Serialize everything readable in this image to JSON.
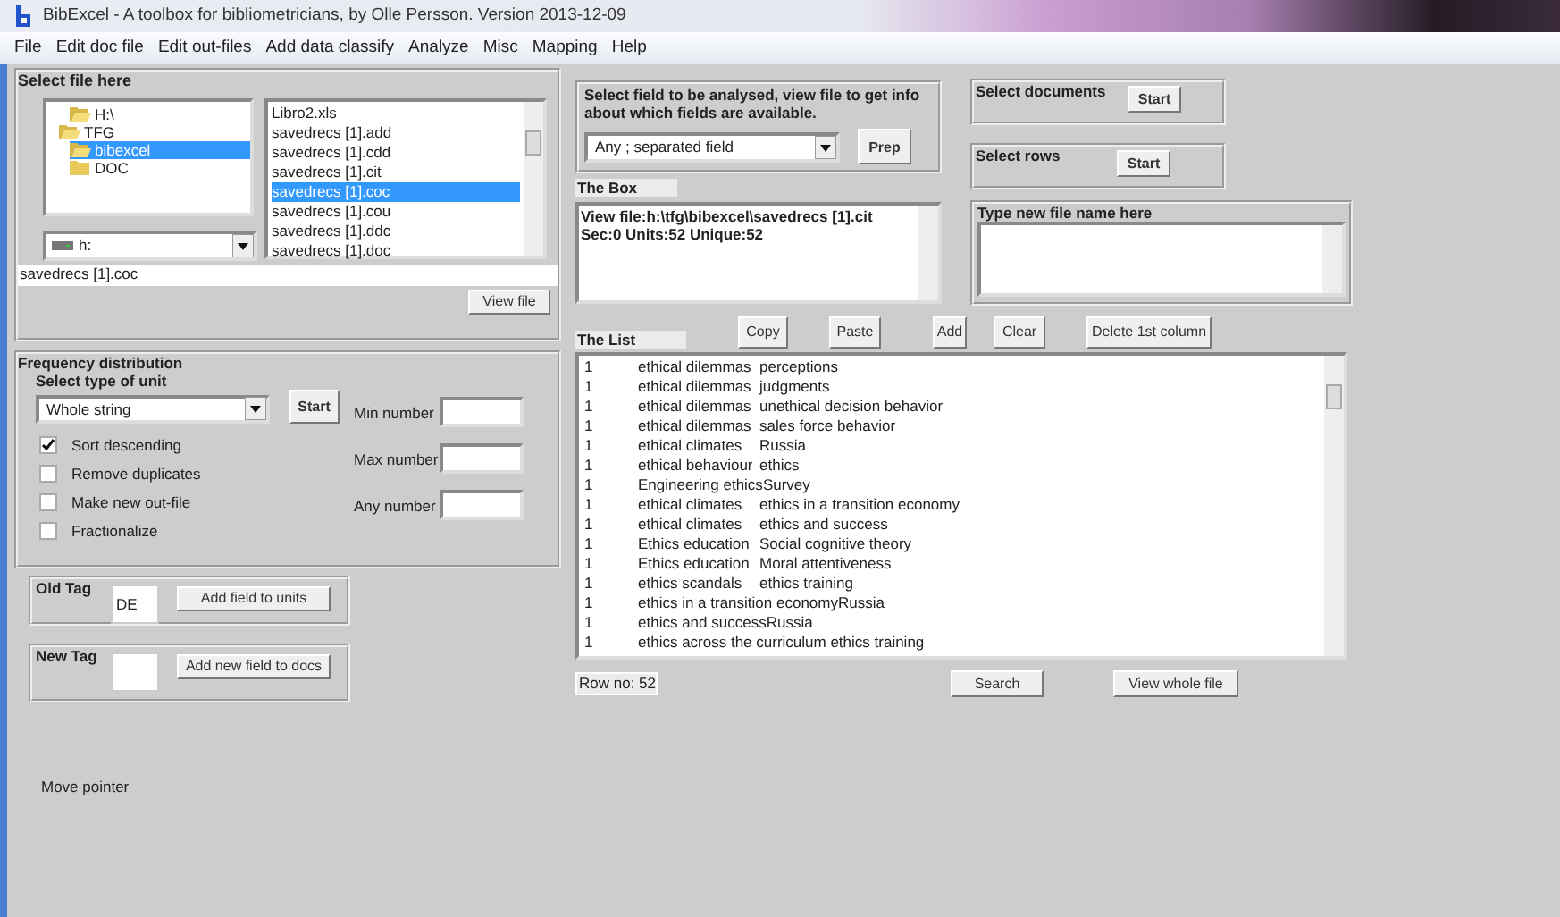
{
  "window": {
    "title": "BibExcel - A toolbox for bibliometricians, by Olle Persson. Version 2013-12-09"
  },
  "menu": [
    "File",
    "Edit doc file",
    "Edit out-files",
    "Add data classify",
    "Analyze",
    "Misc",
    "Mapping",
    "Help"
  ],
  "file_panel": {
    "heading": "Select file here",
    "folders": [
      {
        "label": "H:\\",
        "kind": "open",
        "selected": false
      },
      {
        "label": "TFG",
        "kind": "open",
        "selected": false
      },
      {
        "label": "bibexcel",
        "kind": "open",
        "selected": true
      },
      {
        "label": "DOC",
        "kind": "closed",
        "selected": false
      }
    ],
    "files": [
      {
        "label": "Libro2.xls",
        "selected": false
      },
      {
        "label": "savedrecs [1].add",
        "selected": false
      },
      {
        "label": "savedrecs [1].cdd",
        "selected": false
      },
      {
        "label": "savedrecs [1].cit",
        "selected": false
      },
      {
        "label": "savedrecs [1].coc",
        "selected": true
      },
      {
        "label": "savedrecs [1].cou",
        "selected": false
      },
      {
        "label": "savedrecs [1].ddc",
        "selected": false
      },
      {
        "label": "savedrecs [1].doc",
        "selected": false
      }
    ],
    "drive": "h:",
    "path": "savedrecs [1].coc",
    "view_button": "View file"
  },
  "frequency": {
    "heading": "Frequency distribution",
    "subheading": "Select type of unit",
    "unit": "Whole string",
    "start_button": "Start",
    "checkboxes": [
      {
        "label": "Sort descending",
        "checked": true
      },
      {
        "label": "Remove duplicates",
        "checked": false
      },
      {
        "label": "Make new out-file",
        "checked": false
      },
      {
        "label": "Fractionalize",
        "checked": false
      }
    ],
    "number_fields": [
      "Min number",
      "Max number",
      "Any number"
    ]
  },
  "old_tag": {
    "label": "Old Tag",
    "value": "DE",
    "button": "Add field to units"
  },
  "new_tag": {
    "label": "New Tag",
    "button": "Add new field to docs"
  },
  "status": "Move pointer",
  "field_select": {
    "heading": "Select field to be analysed, view file to get info about which fields are available.",
    "value": "Any ; separated field",
    "button": "Prep"
  },
  "select_documents": {
    "label": "Select documents",
    "button": "Start"
  },
  "select_rows": {
    "label": "Select rows",
    "button": "Start"
  },
  "the_box": {
    "label": "The Box",
    "lines": [
      "View file:h:\\tfg\\bibexcel\\savedrecs [1].cit",
      "Sec:0 Units:52 Unique:52"
    ]
  },
  "new_file": {
    "label": "Type new file name here"
  },
  "the_list": {
    "label": "The List",
    "buttons": [
      "Copy",
      "Paste",
      "Add",
      "Clear",
      "Delete 1st column"
    ],
    "rows": [
      [
        "1",
        "ethical dilemmas",
        "perceptions"
      ],
      [
        "1",
        "ethical dilemmas",
        "judgments"
      ],
      [
        "1",
        "ethical dilemmas",
        "unethical decision behavior"
      ],
      [
        "1",
        "ethical dilemmas",
        "sales force behavior"
      ],
      [
        "1",
        "ethical climates",
        "Russia"
      ],
      [
        "1",
        "ethical behaviour",
        "ethics"
      ],
      [
        "1",
        "Engineering ethics",
        "Survey"
      ],
      [
        "1",
        "ethical climates",
        "ethics in a transition economy"
      ],
      [
        "1",
        "ethical climates",
        "ethics and success"
      ],
      [
        "1",
        "Ethics education",
        "Social cognitive theory"
      ],
      [
        "1",
        "Ethics education",
        "Moral attentiveness"
      ],
      [
        "1",
        "ethics scandals",
        "ethics training"
      ],
      [
        "1",
        "ethics in a transition economy",
        "Russia"
      ],
      [
        "1",
        "ethics and success",
        "Russia"
      ],
      [
        "1",
        "ethics across the curriculum ",
        "ethics training"
      ]
    ]
  },
  "row_no": "Row no: 52",
  "search_button": "Search",
  "view_whole_button": "View whole file"
}
